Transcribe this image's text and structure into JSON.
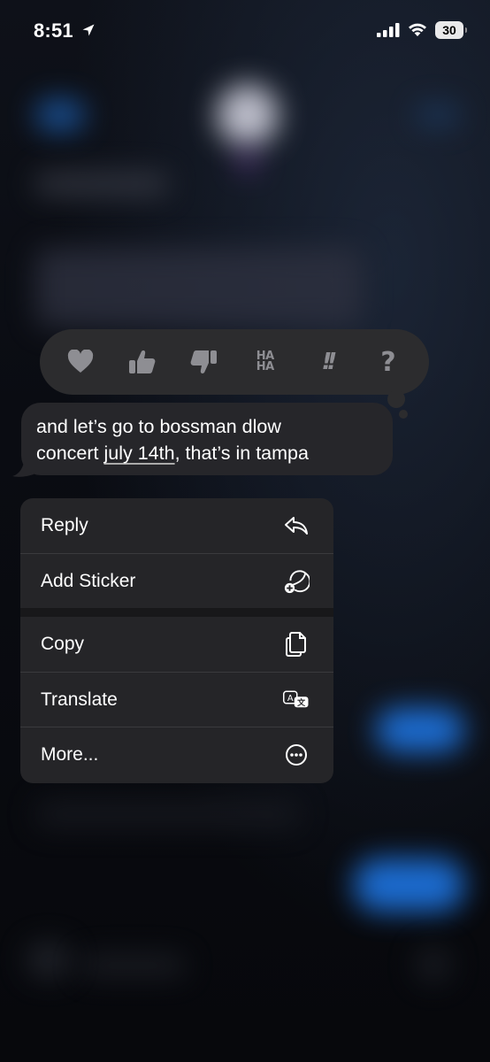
{
  "status_bar": {
    "time": "8:51",
    "battery": "30",
    "icons": [
      "location-arrow-icon",
      "signal-icon",
      "wifi-icon",
      "battery-icon"
    ]
  },
  "reactions": {
    "items": [
      {
        "name": "heart",
        "icon": "heart-icon"
      },
      {
        "name": "thumbs-up",
        "icon": "thumbs-up-icon"
      },
      {
        "name": "thumbs-down",
        "icon": "thumbs-down-icon"
      },
      {
        "name": "haha",
        "label_top": "HA",
        "label_bottom": "HA"
      },
      {
        "name": "emphasize",
        "label": "!!"
      },
      {
        "name": "question",
        "label": "?"
      }
    ]
  },
  "message": {
    "line1": "and let’s go to bossman dlow",
    "line2_prefix": "concert ",
    "line2_link": "july 14th",
    "line2_suffix": ", that’s in tampa"
  },
  "menu": {
    "items": [
      {
        "label": "Reply",
        "icon": "reply-arrow-icon"
      },
      {
        "label": "Add Sticker",
        "icon": "add-sticker-icon"
      },
      {
        "label": "Copy",
        "icon": "copy-icon"
      },
      {
        "label": "Translate",
        "icon": "translate-icon"
      },
      {
        "label": "More...",
        "icon": "more-ellipsis-icon"
      }
    ]
  },
  "colors": {
    "background": "#07080c",
    "panel": "#2c2c2e",
    "menu": "#252528",
    "icon_gray": "#8e8e93",
    "blurred_accent": "#1e7ff0"
  }
}
